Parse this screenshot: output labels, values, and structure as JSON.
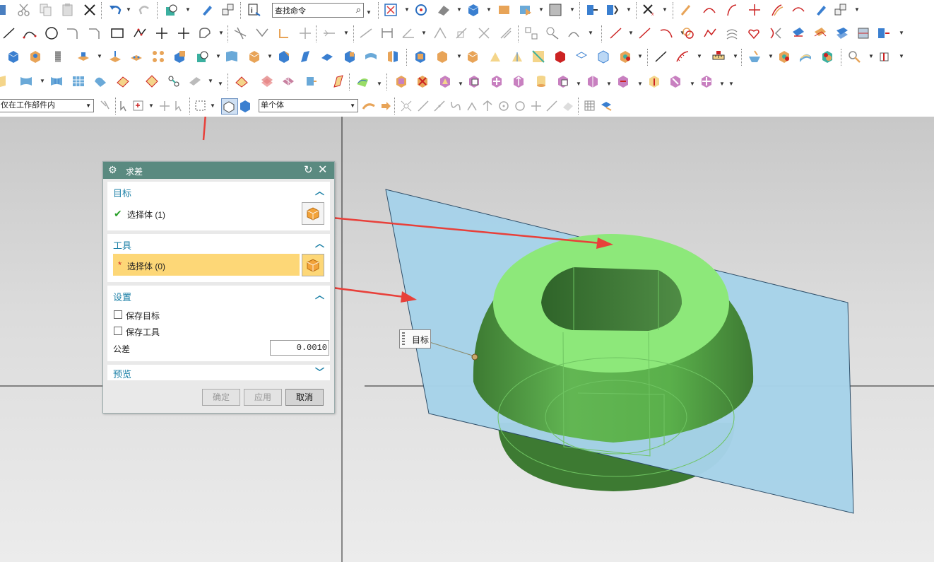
{
  "toolbar": {
    "search_placeholder": "查找命令",
    "scope_filter": "仅在工作部件内",
    "selection_mode": "单个体"
  },
  "dialog": {
    "title": "求差",
    "target": {
      "header": "目标",
      "select_label": "选择体 (1)",
      "status": "selected"
    },
    "tool": {
      "header": "工具",
      "select_label": "选择体 (0)",
      "required_mark": "*"
    },
    "settings": {
      "header": "设置",
      "keep_target_label": "保存目标",
      "keep_target_checked": false,
      "keep_tool_label": "保存工具",
      "keep_tool_checked": false,
      "tolerance_label": "公差",
      "tolerance_value": "0.0010"
    },
    "preview": {
      "header": "预览"
    },
    "buttons": {
      "ok": "确定",
      "apply": "应用",
      "cancel": "取消"
    }
  },
  "viewport": {
    "target_tooltip": "目标"
  },
  "colors": {
    "dialog_title_bg": "#5a8a80",
    "section_header": "#1a7fa6",
    "tool_row_highlight": "#fdd777",
    "body_green": "#5fbf52",
    "body_top_face": "#8de87a",
    "plane_blue": "#a7d3ea",
    "annotation_arrow": "#e8403a"
  }
}
